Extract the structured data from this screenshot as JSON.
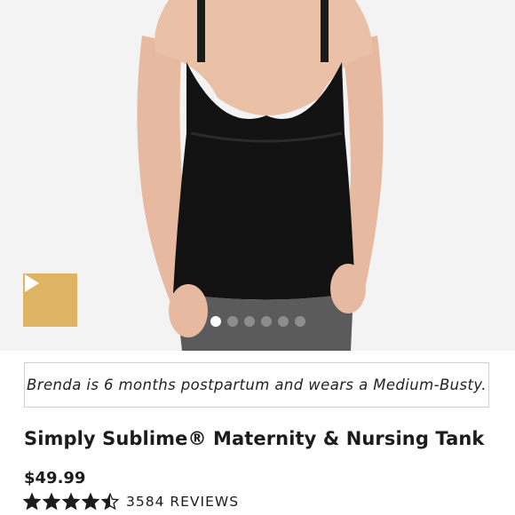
{
  "product": {
    "media": {
      "slide_count": 6,
      "active_slide": 1,
      "play_icon": "play-icon",
      "accent_color": "#dcb464"
    },
    "caption": "Brenda is 6 months postpartum and wears a Medium-Busty.",
    "title": "Simply Sublime® Maternity & Nursing Tank",
    "price": "$49.99",
    "rating": {
      "value": 4.5,
      "max": 5,
      "reviews_label": "3584 REVIEWS"
    }
  }
}
